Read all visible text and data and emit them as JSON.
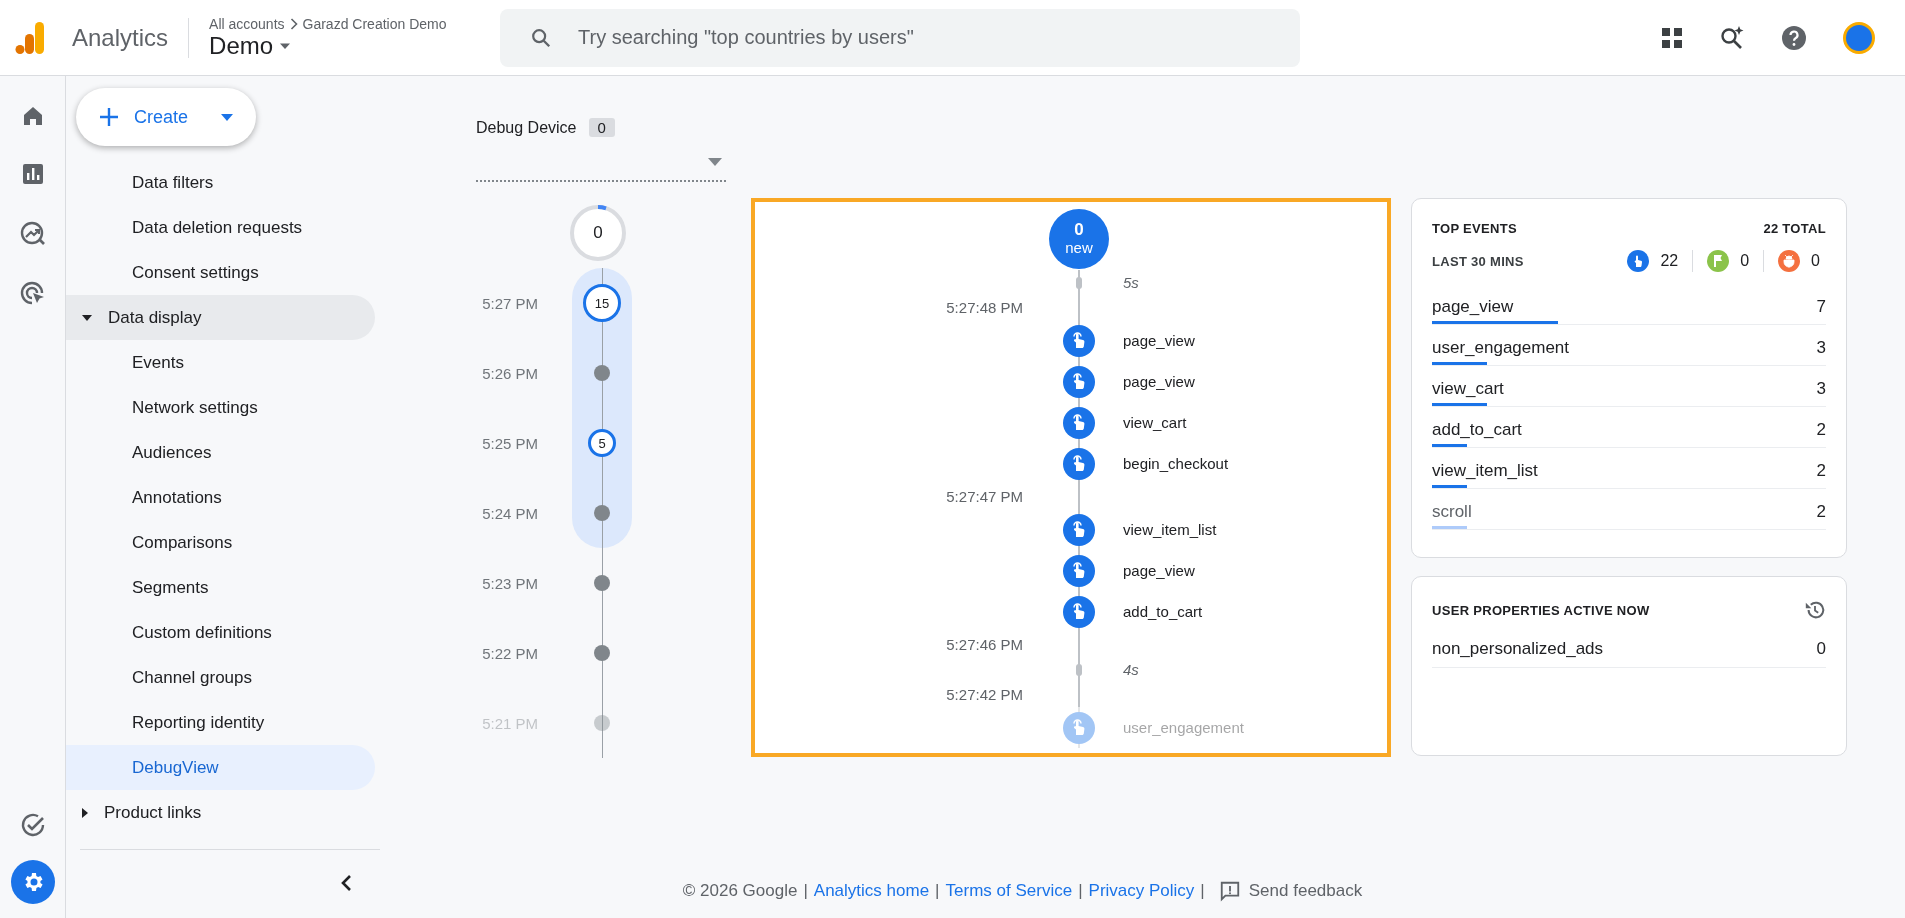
{
  "header": {
    "product": "Analytics",
    "breadcrumb": [
      "All accounts",
      "Garazd Creation Demo"
    ],
    "property": "Demo",
    "search": {
      "placeholder": "Try searching \"top countries by users\""
    }
  },
  "create_button": {
    "label": "Create"
  },
  "nav": [
    {
      "kind": "item",
      "label": "Data filters",
      "selected": false
    },
    {
      "kind": "item",
      "label": "Data deletion requests",
      "selected": false
    },
    {
      "kind": "item",
      "label": "Consent settings",
      "selected": false
    },
    {
      "kind": "section",
      "label": "Data display",
      "expanded": true,
      "children": [
        {
          "label": "Events",
          "selected": false
        },
        {
          "label": "Network settings",
          "selected": false
        },
        {
          "label": "Audiences",
          "selected": false
        },
        {
          "label": "Annotations",
          "selected": false
        },
        {
          "label": "Comparisons",
          "selected": false
        },
        {
          "label": "Segments",
          "selected": false
        },
        {
          "label": "Custom definitions",
          "selected": false
        },
        {
          "label": "Channel groups",
          "selected": false
        },
        {
          "label": "Reporting identity",
          "selected": false
        },
        {
          "label": "DebugView",
          "selected": true
        }
      ]
    },
    {
      "kind": "section",
      "label": "Product links",
      "expanded": false
    }
  ],
  "debug_device": {
    "label": "Debug Device",
    "count": "0"
  },
  "minutes": {
    "top_count": "0",
    "rows": [
      {
        "time": "5:27 PM",
        "count": "15",
        "selected": true
      },
      {
        "time": "5:26 PM",
        "selected": true
      },
      {
        "time": "5:25 PM",
        "count": "5",
        "selected": true
      },
      {
        "time": "5:24 PM",
        "selected": true
      },
      {
        "time": "5:23 PM",
        "selected": false
      },
      {
        "time": "5:22 PM",
        "selected": false
      },
      {
        "time": "5:21 PM",
        "selected": false
      }
    ]
  },
  "stream": {
    "new_count": "0",
    "new_label": "new",
    "items": [
      {
        "kind": "gap",
        "text": "5s"
      },
      {
        "kind": "time",
        "text": "5:27:48 PM"
      },
      {
        "kind": "event",
        "text": "page_view"
      },
      {
        "kind": "event",
        "text": "page_view"
      },
      {
        "kind": "event",
        "text": "view_cart"
      },
      {
        "kind": "event",
        "text": "begin_checkout"
      },
      {
        "kind": "time",
        "text": "5:27:47 PM"
      },
      {
        "kind": "event",
        "text": "view_item_list"
      },
      {
        "kind": "event",
        "text": "page_view"
      },
      {
        "kind": "event",
        "text": "add_to_cart"
      },
      {
        "kind": "time",
        "text": "5:27:46 PM"
      },
      {
        "kind": "gap",
        "text": "4s"
      },
      {
        "kind": "time",
        "text": "5:27:42 PM"
      },
      {
        "kind": "event",
        "text": "user_engagement"
      }
    ]
  },
  "top_events": {
    "title": "TOP EVENTS",
    "total": "22 TOTAL",
    "period": "LAST 30 MINS",
    "counters": [
      {
        "kind": "event",
        "value": "22",
        "color": "#1a73e8"
      },
      {
        "kind": "conversion",
        "value": "0",
        "color": "#8bc34a"
      },
      {
        "kind": "error",
        "value": "0",
        "color": "#f4703f"
      }
    ],
    "rows": [
      {
        "name": "page_view",
        "count": "7",
        "level": 0.32
      },
      {
        "name": "user_engagement",
        "count": "3",
        "level": 0.14
      },
      {
        "name": "view_cart",
        "count": "3",
        "level": 0.14
      },
      {
        "name": "add_to_cart",
        "count": "2",
        "level": 0.09
      },
      {
        "name": "view_item_list",
        "count": "2",
        "level": 0.09
      },
      {
        "name": "scroll",
        "count": "2",
        "level": 0.09
      }
    ]
  },
  "user_properties": {
    "title": "USER PROPERTIES ACTIVE NOW",
    "rows": [
      {
        "name": "non_personalized_ads",
        "value": "0"
      }
    ]
  },
  "footer": [
    {
      "kind": "text",
      "text": "© 2026 Google"
    },
    {
      "kind": "sep",
      "text": "|"
    },
    {
      "kind": "link",
      "text": "Analytics home"
    },
    {
      "kind": "sep",
      "text": "|"
    },
    {
      "kind": "link",
      "text": "Terms of Service"
    },
    {
      "kind": "sep",
      "text": "|"
    },
    {
      "kind": "link",
      "text": "Privacy Policy"
    },
    {
      "kind": "sep",
      "text": "|"
    },
    {
      "kind": "feedback",
      "text": "Send feedback"
    }
  ]
}
